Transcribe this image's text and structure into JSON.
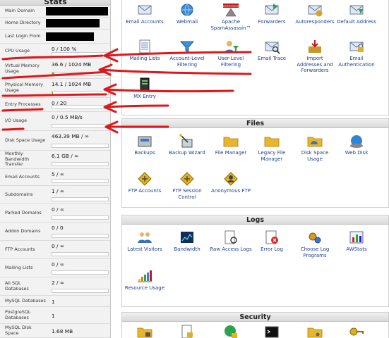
{
  "stats": {
    "title": "Stats",
    "rows": [
      {
        "key": "main_domain",
        "label": "Main Domain",
        "value": ""
      },
      {
        "key": "home_directory",
        "label": "Home Directory",
        "value": ""
      },
      {
        "key": "last_login_from",
        "label": "Last Login From",
        "value": ""
      },
      {
        "key": "cpu_usage",
        "label": "CPU Usage",
        "value": "0 / 100 %",
        "percent": 0
      },
      {
        "key": "virtual_memory",
        "label": "Virtual Memory Usage",
        "value": "36.6 / 1024 MB",
        "percent": 3.6
      },
      {
        "key": "physical_memory",
        "label": "Physical Memory Usage",
        "value": "14.1 / 1024 MB",
        "percent": 1.4
      },
      {
        "key": "entry_processes",
        "label": "Entry Processes",
        "value": "0 / 20",
        "percent": 0
      },
      {
        "key": "io_usage",
        "label": "I/O Usage",
        "value": "0 / 0.5 MB/s",
        "percent": 0
      },
      {
        "key": "disk_space",
        "label": "Disk Space Usage",
        "value": "463.39 MB / ∞",
        "percent": 0
      },
      {
        "key": "monthly_bandwidth",
        "label": "Monthly Bandwidth Transfer",
        "value": "6.1 GB / ∞",
        "percent": 0
      },
      {
        "key": "email_accounts",
        "label": "Email Accounts",
        "value": "5 / ∞",
        "percent": 0
      },
      {
        "key": "subdomains",
        "label": "Subdomains",
        "value": "1 / ∞",
        "percent": 0
      },
      {
        "key": "parked_domains",
        "label": "Parked Domains",
        "value": "0 / ∞",
        "percent": 0
      },
      {
        "key": "addon_domains",
        "label": "Addon Domains",
        "value": "0 / 0",
        "percent": 0
      },
      {
        "key": "ftp_accounts",
        "label": "FTP Accounts",
        "value": "0 / ∞",
        "percent": 0
      },
      {
        "key": "mailing_lists",
        "label": "Mailing Lists",
        "value": "0 / ∞",
        "percent": 0
      },
      {
        "key": "all_sql_databases",
        "label": "All SQL Databases",
        "value": "2 / ∞",
        "percent": 0
      },
      {
        "key": "mysql_databases",
        "label": "MySQL Databases",
        "value": "1"
      },
      {
        "key": "postgresql_databases",
        "label": "PostgreSQL Databases",
        "value": "1"
      },
      {
        "key": "mysql_disk_space",
        "label": "MySQL Disk Space",
        "value": "1.68 MB"
      }
    ]
  },
  "mail": {
    "items": [
      {
        "key": "email_accounts",
        "label": "Email Accounts",
        "icon": "envelope-icon"
      },
      {
        "key": "webmail",
        "label": "Webmail",
        "icon": "globe-envelope-icon"
      },
      {
        "key": "spamassassin",
        "label": "Apache SpamAssassin™",
        "badge": "SpamAssassin",
        "icon": "spamassassin-icon"
      },
      {
        "key": "forwarders",
        "label": "Forwarders",
        "icon": "forwarders-icon"
      },
      {
        "key": "autoresponders",
        "label": "Autoresponders",
        "icon": "autoresponder-icon"
      },
      {
        "key": "default_address",
        "label": "Default Address",
        "icon": "default-address-icon"
      },
      {
        "key": "mailing_lists",
        "label": "Mailing Lists",
        "icon": "mailing-list-icon"
      },
      {
        "key": "account_filtering",
        "label": "Account-Level Filtering",
        "icon": "filter-icon"
      },
      {
        "key": "user_filtering",
        "label": "User-Level Filtering",
        "icon": "user-filter-icon"
      },
      {
        "key": "email_trace",
        "label": "Email Trace",
        "icon": "trace-icon"
      },
      {
        "key": "import_addresses",
        "label": "Import Addresses and Forwarders",
        "icon": "import-icon"
      },
      {
        "key": "email_authentication",
        "label": "Email Authentication",
        "icon": "authentication-icon"
      },
      {
        "key": "mx_entry",
        "label": "MX Entry",
        "icon": "server-icon"
      }
    ]
  },
  "files": {
    "title": "Files",
    "items": [
      {
        "key": "backups",
        "label": "Backups",
        "icon": "backup-icon"
      },
      {
        "key": "backup_wizard",
        "label": "Backup Wizard",
        "icon": "wand-icon"
      },
      {
        "key": "file_manager",
        "label": "File Manager",
        "icon": "folder-icon"
      },
      {
        "key": "legacy_file_manager",
        "label": "Legacy File Manager",
        "icon": "folder-icon"
      },
      {
        "key": "disk_space_usage",
        "label": "Disk Space Usage",
        "icon": "folder-chart-icon"
      },
      {
        "key": "web_disk",
        "label": "Web Disk",
        "icon": "globe-disk-icon"
      },
      {
        "key": "ftp_accounts",
        "label": "FTP Accounts",
        "icon": "ftp-icon"
      },
      {
        "key": "ftp_session_control",
        "label": "FTP Session Control",
        "icon": "ftp-icon"
      },
      {
        "key": "anonymous_ftp",
        "label": "Anonymous FTP",
        "icon": "anonymous-icon"
      }
    ]
  },
  "logs": {
    "title": "Logs",
    "items": [
      {
        "key": "latest_visitors",
        "label": "Latest Visitors",
        "icon": "visitors-icon"
      },
      {
        "key": "bandwidth",
        "label": "Bandwidth",
        "icon": "bandwidth-icon"
      },
      {
        "key": "raw_access_logs",
        "label": "Raw Access Logs",
        "icon": "log-icon"
      },
      {
        "key": "error_log",
        "label": "Error Log",
        "icon": "error-icon"
      },
      {
        "key": "choose_log_programs",
        "label": "Choose Log Programs",
        "icon": "gears-icon"
      },
      {
        "key": "awstats",
        "label": "AWStats",
        "icon": "chart-icon"
      },
      {
        "key": "resource_usage",
        "label": "Resource Usage",
        "icon": "bar-chart-icon"
      }
    ]
  },
  "security": {
    "title": "Security",
    "items": [
      {
        "key": "security_1",
        "label": "",
        "icon": "folder-lock-icon"
      },
      {
        "key": "security_2",
        "label": "",
        "icon": "document-lock-icon"
      },
      {
        "key": "security_3",
        "label": "",
        "icon": "globe-lock-icon"
      },
      {
        "key": "security_4",
        "label": "",
        "icon": "terminal-icon"
      },
      {
        "key": "security_5",
        "label": "",
        "icon": "folder-key-icon"
      },
      {
        "key": "security_6",
        "label": "",
        "icon": "key-icon"
      }
    ]
  },
  "colors": {
    "annotation": "#e0161a",
    "usage_bar": "#56c33a",
    "link": "#1c3f8f"
  }
}
